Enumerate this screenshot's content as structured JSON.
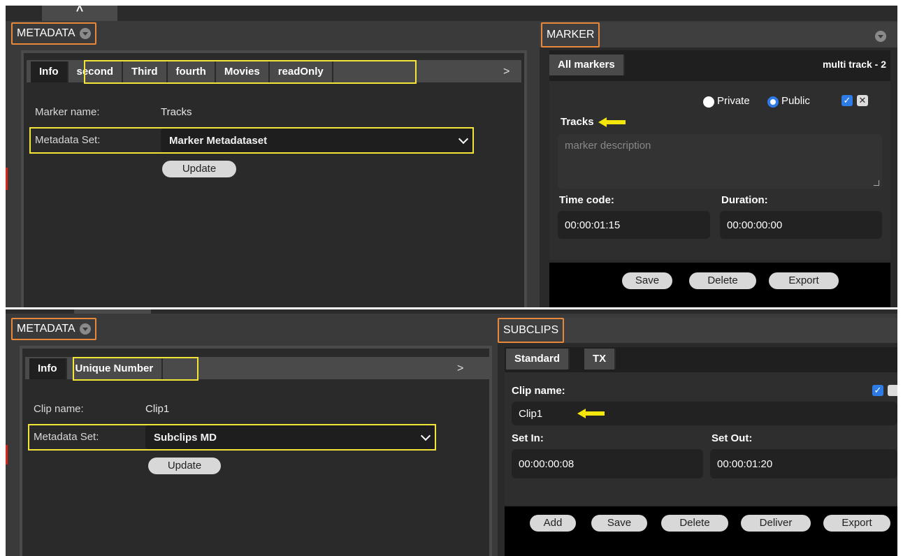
{
  "top": {
    "metadata": {
      "title": "METADATA",
      "tabs": [
        "Info",
        "second",
        "Third",
        "fourth",
        "Movies",
        "readOnly"
      ],
      "more": ">",
      "marker_name_label": "Marker name:",
      "marker_name_value": "Tracks",
      "metadata_set_label": "Metadata Set:",
      "metadata_set_value": "Marker Metadataset",
      "update_label": "Update",
      "handle_glyph": "^"
    },
    "marker": {
      "title": "MARKER",
      "tab": "All markers",
      "track_info": "multi track - 2",
      "private_label": "Private",
      "public_label": "Public",
      "name": "Tracks",
      "description_placeholder": "marker description",
      "time_code_label": "Time code:",
      "time_code_value": "00:00:01:15",
      "duration_label": "Duration:",
      "duration_value": "00:00:00:00",
      "save_label": "Save",
      "delete_label": "Delete",
      "export_label": "Export"
    }
  },
  "bottom": {
    "metadata": {
      "title": "METADATA",
      "tabs": [
        "Info",
        "Unique Number"
      ],
      "more": ">",
      "clip_name_label": "Clip name:",
      "clip_name_value": "Clip1",
      "metadata_set_label": "Metadata Set:",
      "metadata_set_value": "Subclips MD",
      "update_label": "Update"
    },
    "subclips": {
      "title": "SUBCLIPS",
      "tabs": [
        "Standard",
        "TX"
      ],
      "clip_name_label": "Clip name:",
      "clip_name_value": "Clip1",
      "set_in_label": "Set In:",
      "set_in_value": "00:00:00:08",
      "set_out_label": "Set Out:",
      "set_out_value": "00:00:01:20",
      "add_label": "Add",
      "save_label": "Save",
      "delete_label": "Delete",
      "deliver_label": "Deliver",
      "export_label": "Export"
    }
  },
  "colors": {
    "highlight_orange": "#e8883a",
    "highlight_yellow": "#f4e43a",
    "accent_blue": "#2f7be6"
  }
}
